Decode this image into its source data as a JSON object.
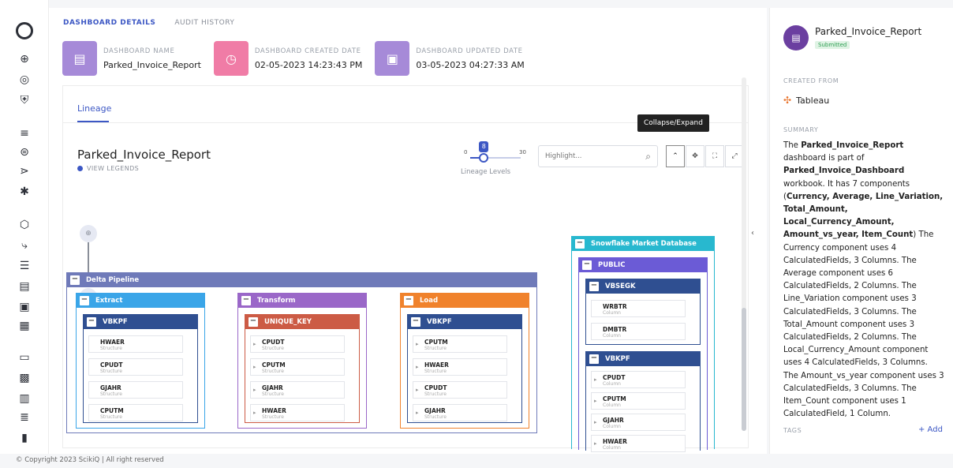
{
  "tabs": {
    "details": "DASHBOARD DETAILS",
    "audit": "AUDIT HISTORY"
  },
  "info": {
    "name_label": "DASHBOARD NAME",
    "name_value": "Parked_Invoice_Report",
    "created_label": "DASHBOARD CREATED DATE",
    "created_value": "02-05-2023 14:23:43 PM",
    "updated_label": "DASHBOARD UPDATED DATE",
    "updated_value": "03-05-2023 04:27:33 AM",
    "colors": {
      "name": "#a68ad8",
      "created": "#f07ca6",
      "updated": "#a68ad8"
    }
  },
  "lineage": {
    "tab": "Lineage",
    "title": "Parked_Invoice_Report",
    "legend": "VIEW LEGENDS",
    "slider": {
      "min": "0",
      "max": "30",
      "value": "8",
      "caption": "Lineage Levels",
      "fraction": 0.27
    },
    "search_placeholder": "Highlight...",
    "tooltip": "Collapse/Expand"
  },
  "pipeline": {
    "delta": {
      "name": "Delta Pipeline",
      "color": "#6f7ab9"
    },
    "extract": {
      "name": "Extract",
      "color": "#3aa5e8",
      "table": "VBKPF",
      "table_color": "#2f4f91",
      "fields": [
        {
          "n": "HWAER",
          "t": "Structure"
        },
        {
          "n": "CPUDT",
          "t": "Structure"
        },
        {
          "n": "GJAHR",
          "t": "Structure"
        },
        {
          "n": "CPUTM",
          "t": "Structure"
        }
      ]
    },
    "transform": {
      "name": "Transform",
      "color": "#9a67c8",
      "table": "UNIQUE_KEY",
      "table_color": "#cc5b45",
      "fields": [
        {
          "n": "CPUDT",
          "t": "Structure"
        },
        {
          "n": "CPUTM",
          "t": "Structure"
        },
        {
          "n": "GJAHR",
          "t": "Structure"
        },
        {
          "n": "HWAER",
          "t": "Structure"
        }
      ]
    },
    "load": {
      "name": "Load",
      "color": "#f0822c",
      "table": "VBKPF",
      "table_color": "#2f4f91",
      "fields": [
        {
          "n": "CPUTM",
          "t": "Structure"
        },
        {
          "n": "HWAER",
          "t": "Structure"
        },
        {
          "n": "CPUDT",
          "t": "Structure"
        },
        {
          "n": "GJAHR",
          "t": "Structure"
        }
      ]
    },
    "snowflake": {
      "name": "Snowflake Market Database",
      "color": "#28b8cf",
      "schema": "PUBLIC",
      "schema_color": "#6b5bd6",
      "t1": "VBSEGK",
      "t1_color": "#2f4f91",
      "t1_fields": [
        {
          "n": "WRBTR",
          "t": "Column"
        },
        {
          "n": "DMBTR",
          "t": "Column"
        }
      ],
      "t2": "VBKPF",
      "t2_color": "#2f4f91",
      "t2_fields": [
        {
          "n": "CPUDT",
          "t": "Column"
        },
        {
          "n": "CPUTM",
          "t": "Column"
        },
        {
          "n": "GJAHR",
          "t": "Column"
        },
        {
          "n": "HWAER",
          "t": "Column"
        }
      ]
    }
  },
  "right": {
    "title": "Parked_Invoice_Report",
    "status": "Submitted",
    "created_from_label": "CREATED FROM",
    "source": "Tableau",
    "summary_label": "SUMMARY",
    "summary": {
      "s1": "The ",
      "b1": "Parked_Invoice_Report",
      "s2": " dashboard is part of ",
      "b2": "Parked_Invoice_Dashboard",
      "s3": " workbook. It has 7 components (",
      "b3": "Currency, Average, Line_Variation, Total_Amount, Local_Currency_Amount, Amount_vs_year, Item_Count",
      "s4": ") The Currency component uses 4 CalculatedFields, 3 Columns. The Average component uses 6 CalculatedFields, 2 Columns. The Line_Variation component uses 3 CalculatedFields, 3 Columns. The Total_Amount component uses 3 CalculatedFields, 2 Columns. The Local_Currency_Amount component uses 4 CalculatedFields, 3 Columns. The Amount_vs_year component uses 3 CalculatedFields, 3 Columns. The Item_Count component uses 1 CalculatedField, 1 Column."
    },
    "tags_label": "TAGS",
    "add": "+ Add"
  },
  "footer": "© Copyright 2023 ScikiQ | All right reserved"
}
